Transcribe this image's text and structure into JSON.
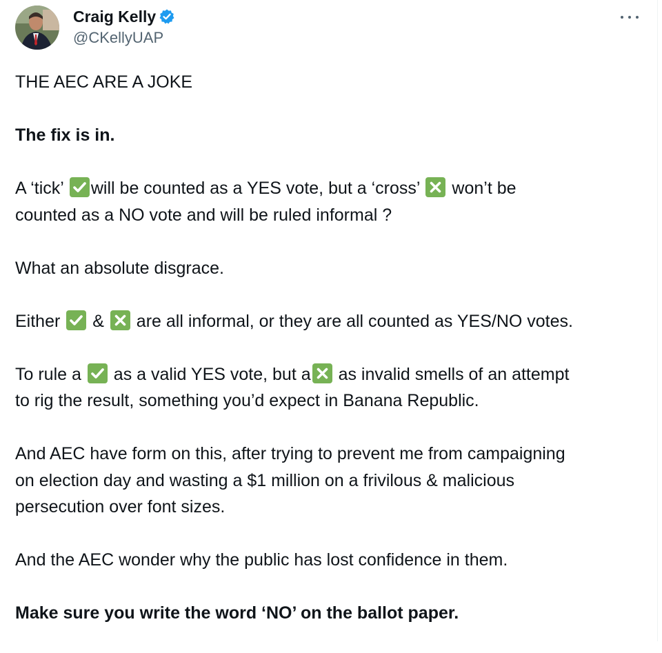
{
  "author": {
    "display_name": "Craig Kelly",
    "handle": "@CKellyUAP",
    "verified": true
  },
  "icons": {
    "avatar": "profile-photo",
    "verified": "verified-badge-icon",
    "more": "more-options-icon",
    "tick": "check-mark-button-emoji",
    "cross": "cross-mark-button-emoji"
  },
  "colors": {
    "verified": "#1d9bf0",
    "emoji_bg": "#77b255",
    "text": "#0f1419",
    "muted": "#536471"
  },
  "tweet": {
    "p1": "THE AEC ARE A JOKE",
    "p2": "The fix is in.",
    "p3a": "A  ‘tick’ ",
    "p3b": "will be counted as a YES vote, but a ‘cross’ ",
    "p3c": " won’t  be",
    "p3d": "counted as a NO vote and will be ruled  informal  ?",
    "p4": "What an absolute disgrace.",
    "p5a": "Either ",
    "p5b": " & ",
    "p5c": " are all informal, or they are all counted as YES/NO  votes.",
    "p6a": "To rule a ",
    "p6b": " as a valid YES  vote,  but a",
    "p6c": " as invalid smells of an attempt",
    "p6d": "to rig the result, something you’d  expect in Banana  Republic.",
    "p7a": "And AEC have form on this, after trying to prevent me  from campaigning",
    "p7b": "on election day and wasting  a $1  million on a frivilous  & malicious",
    "p7c": "persecution over font  sizes.",
    "p8": "And the AEC wonder why the public has lost  confidence in them.",
    "p9": "Make sure you write the word  ‘NO’ on the ballot  paper."
  }
}
